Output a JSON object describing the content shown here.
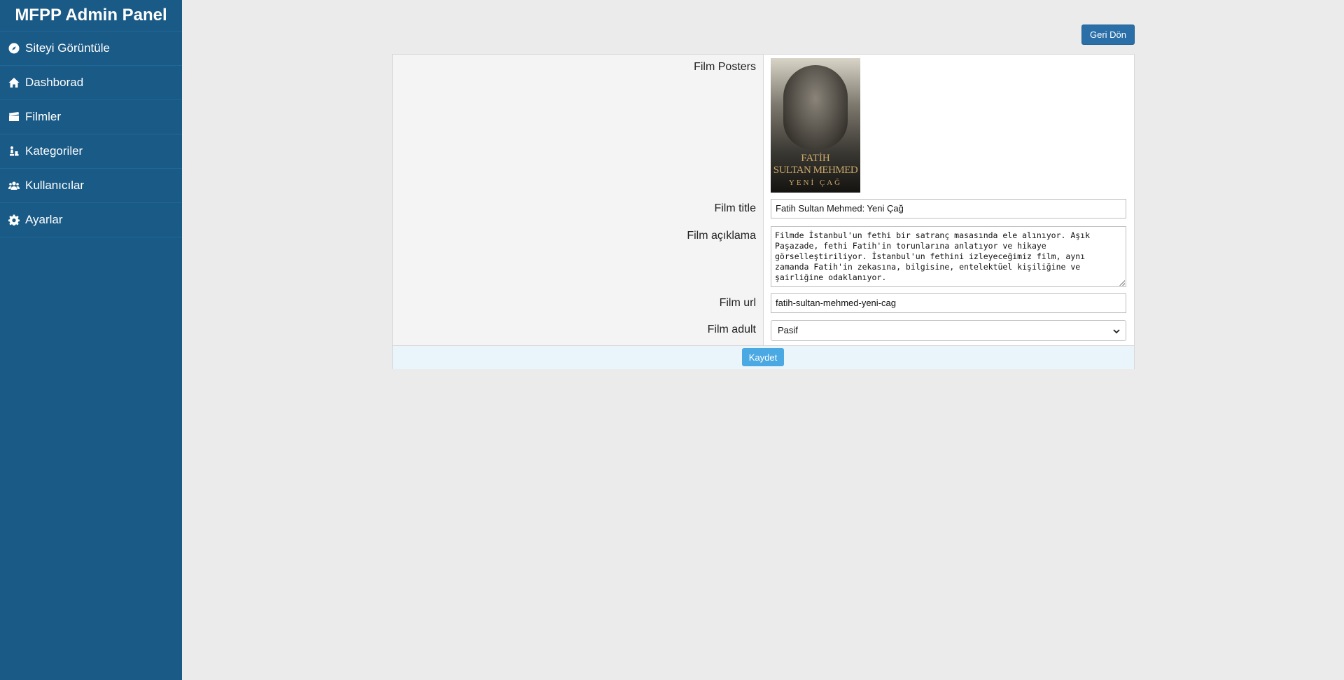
{
  "sidebar": {
    "brand": "MFPP Admin Panel",
    "items": [
      {
        "label": "Siteyi Görüntüle",
        "icon": "compass-icon"
      },
      {
        "label": "Dashborad",
        "icon": "home-icon"
      },
      {
        "label": "Filmler",
        "icon": "clapperboard-icon"
      },
      {
        "label": "Kategoriler",
        "icon": "chess-icon"
      },
      {
        "label": "Kullanıcılar",
        "icon": "users-icon"
      },
      {
        "label": "Ayarlar",
        "icon": "gear-icon"
      }
    ]
  },
  "header": {
    "back_label": "Geri Dön"
  },
  "form": {
    "poster_label": "Film Posters",
    "poster_text": {
      "line1": "FATİH",
      "line2": "SULTAN MEHMED",
      "line3": "YENİ ÇAĞ"
    },
    "title_label": "Film title",
    "title_value": "Fatih Sultan Mehmed: Yeni Çağ",
    "desc_label": "Film açıklama",
    "desc_value": "Filmde İstanbul'un fethi bir satranç masasında ele alınıyor. Aşık Paşazade, fethi Fatih'in torunlarına anlatıyor ve hikaye görselleştiriliyor. İstanbul'un fethini izleyeceğimiz film, aynı zamanda Fatih'in zekasına, bilgisine, entelektüel kişiliğine ve şairliğine odaklanıyor.",
    "url_label": "Film url",
    "url_value": "fatih-sultan-mehmed-yeni-cag",
    "adult_label": "Film adult",
    "adult_value": "Pasif",
    "save_label": "Kaydet"
  }
}
